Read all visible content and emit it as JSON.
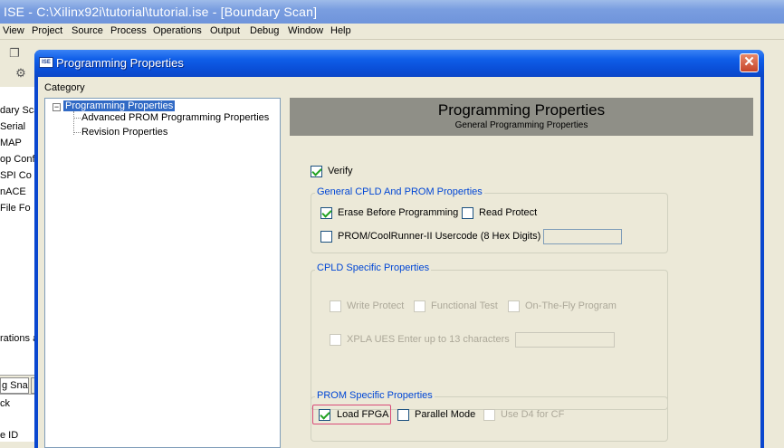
{
  "app": {
    "title": "ISE - C:\\Xilinx92i\\tutorial\\tutorial.ise - [Boundary Scan]",
    "menu": [
      "View",
      "Project",
      "Source",
      "Process",
      "Operations",
      "Output",
      "Debug",
      "Window",
      "Help"
    ]
  },
  "left_panel": {
    "lines": [
      "dary Sca",
      "Serial",
      "MAP",
      "op Confi",
      "SPI Co",
      "nACE",
      "File Fo"
    ],
    "tab_label": "g Snap",
    "bottom_lines": [
      "rations a",
      "ck",
      "e ID"
    ]
  },
  "dialog": {
    "title": "Programming Properties",
    "icon_text": "ISE",
    "close_glyph": "✕",
    "category_label": "Category",
    "tree": {
      "expander": "−",
      "root": "Programming Properties",
      "children": [
        "Advanced PROM Programming Properties",
        "Revision Properties"
      ]
    },
    "header": {
      "title": "Programming Properties",
      "subtitle": "General Programming Properties"
    },
    "verify": {
      "label": "Verify",
      "checked": true
    },
    "general_group": {
      "title": "General CPLD And PROM Properties",
      "erase": {
        "label": "Erase Before Programming",
        "checked": true
      },
      "read_protect": {
        "label": "Read Protect",
        "checked": false
      },
      "usercode": {
        "label": "PROM/CoolRunner-II Usercode (8 Hex Digits)",
        "checked": false,
        "value": ""
      }
    },
    "cpld_group": {
      "title": "CPLD Specific Properties",
      "write_protect": {
        "label": "Write Protect",
        "checked": false,
        "enabled": false
      },
      "functional_test": {
        "label": "Functional Test",
        "checked": false,
        "enabled": false
      },
      "on_the_fly": {
        "label": "On-The-Fly Program",
        "checked": false,
        "enabled": false
      },
      "xpla_ues": {
        "label": "XPLA UES  Enter up to 13 characters",
        "checked": false,
        "enabled": false,
        "value": ""
      }
    },
    "prom_group": {
      "title": "PROM Specific Properties",
      "load_fpga": {
        "label": "Load FPGA",
        "checked": true
      },
      "parallel_mode": {
        "label": "Parallel Mode",
        "checked": false
      },
      "use_d4": {
        "label": "Use D4 for CF",
        "checked": false,
        "enabled": false
      }
    }
  },
  "colors": {
    "dialog_titlebar": "#0a4fd8",
    "tree_selection": "#316ac5",
    "group_title": "#0046d5",
    "header_band": "#8f8f87",
    "highlight": "#d94a78",
    "checkmark": "#21a121"
  }
}
